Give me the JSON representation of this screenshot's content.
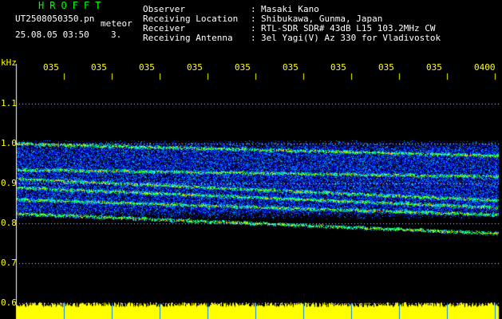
{
  "header": {
    "station_code": "HROFFT",
    "filename": "UT2508050350.pn",
    "filename_suffix": "meteor",
    "datetime": "25.08.05 03:50",
    "frame_no": "3.",
    "meta": [
      {
        "label": "Observer",
        "value": "Masaki Kano"
      },
      {
        "label": "Receiving Location",
        "value": "Shibukawa, Gunma, Japan"
      },
      {
        "label": "Receiver",
        "value": "RTL-SDR SDR# 43dB L15 103.2MHz CW"
      },
      {
        "label": "Receiving Antenna",
        "value": "3el Yagi(V) Az 330 for Vladivostok"
      }
    ]
  },
  "chart_data": {
    "type": "heatmap",
    "ylabel": "kHz",
    "ylim": [
      0.6,
      1.2
    ],
    "y_ticks": [
      "1.1",
      "1.0",
      "0.9",
      "0.8",
      "0.7",
      "0.6"
    ],
    "x_ticks": [
      "035",
      "035",
      "035",
      "035",
      "035",
      "035",
      "035",
      "035",
      "035",
      "0400"
    ],
    "signal_band": [
      0.81,
      1.01
    ],
    "traces": [
      {
        "start": 0.912,
        "end": 0.858
      },
      {
        "start": 0.89,
        "end": 0.84
      },
      {
        "start": 0.86,
        "end": 0.822
      },
      {
        "start": 0.825,
        "end": 0.775
      },
      {
        "start": 0.935,
        "end": 0.918
      },
      {
        "start": 1.0,
        "end": 0.97
      }
    ],
    "colors": {
      "background": "#000000",
      "grid": "#d8d8ff",
      "axis_text": "#ffff00",
      "noise_bar": "#ffff00",
      "noise_low": "#0000c8",
      "noise_high": "#ff0000"
    }
  }
}
